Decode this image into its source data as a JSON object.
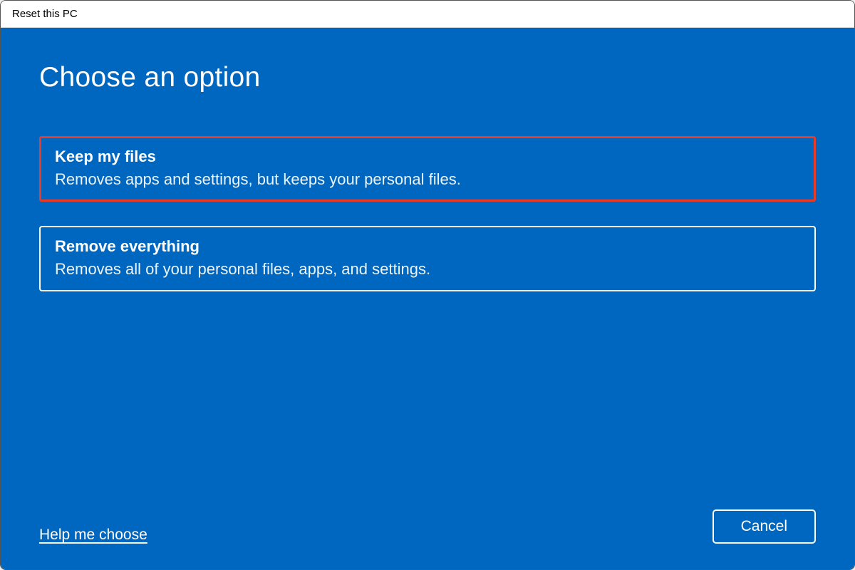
{
  "titlebar": {
    "title": "Reset this PC"
  },
  "main": {
    "heading": "Choose an option",
    "options": [
      {
        "title": "Keep my files",
        "description": "Removes apps and settings, but keeps your personal files.",
        "highlighted": true
      },
      {
        "title": "Remove everything",
        "description": "Removes all of your personal files, apps, and settings.",
        "highlighted": false
      }
    ]
  },
  "footer": {
    "help_link": "Help me choose",
    "cancel_label": "Cancel"
  },
  "colors": {
    "primary_blue": "#0067c0",
    "highlight_red": "#e83c2a",
    "white": "#ffffff"
  }
}
